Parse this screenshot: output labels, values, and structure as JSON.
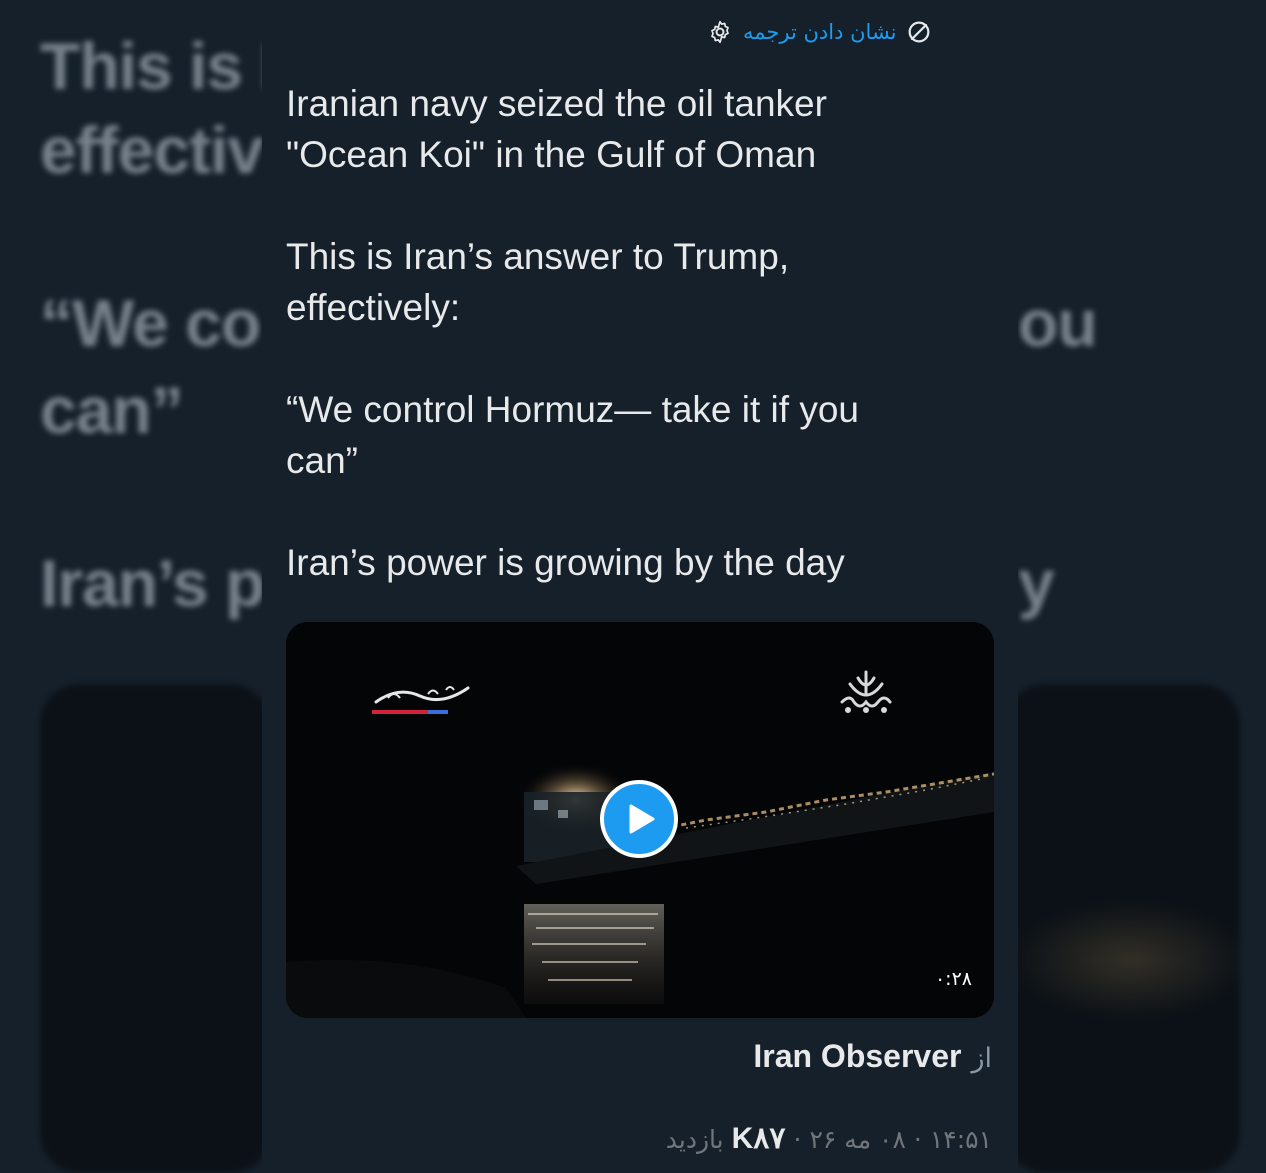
{
  "background_echo": {
    "lines": [
      "This is I",
      "effectiv",
      "“We co",
      "ou",
      "can”",
      "Iran’s p",
      "y"
    ]
  },
  "translate": {
    "label": "نشان دادن ترجمه",
    "icon": "translate-globe-icon",
    "settings_icon": "gear-icon"
  },
  "tweet": {
    "text": "Iranian navy seized the oil tanker\n\"Ocean Koi\" in the Gulf of Oman\n\nThis is Iran’s answer to Trump,\neffectively:\n\n“We control Hormuz— take it if you\ncan”\n\nIran’s power is growing by the day"
  },
  "media": {
    "duration": "۰:۲۸",
    "play_icon": "play-icon",
    "left_watermark": "news-agency-logo",
    "right_watermark": "iribb-emblem"
  },
  "attribution": {
    "prefix": "از",
    "source": "Iran Observer"
  },
  "meta": {
    "time": "۱۴:۵۱",
    "separator": "·",
    "date": "۰۸ مه ۲۶",
    "views_count": "K۸۷",
    "views_label": "بازدید"
  },
  "colors": {
    "background": "#15202b",
    "text": "#e7e9ea",
    "link": "#1d9bf0",
    "muted": "#71767b"
  }
}
